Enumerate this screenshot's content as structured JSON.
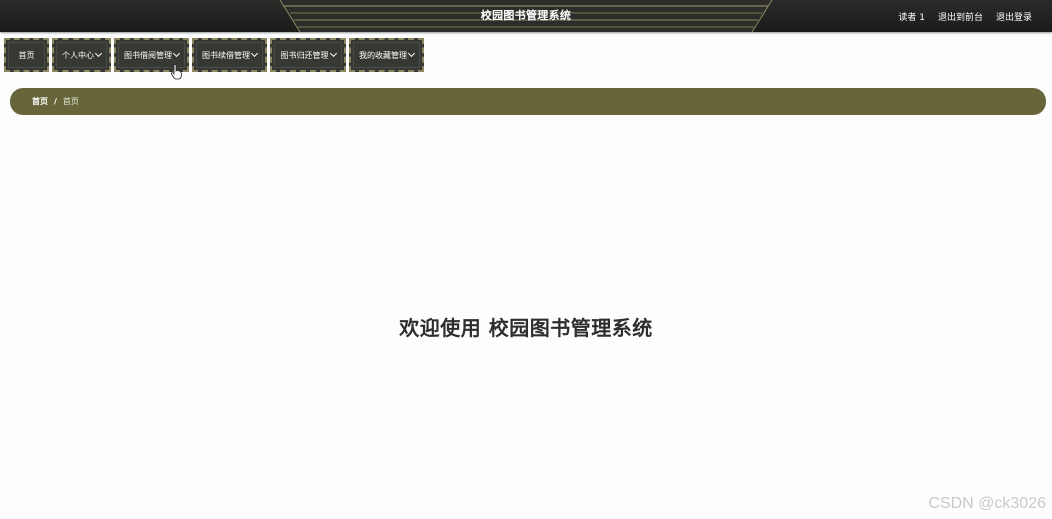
{
  "header": {
    "title": "校园图书管理系统",
    "user_label": "读者 1",
    "links": [
      "退出到前台",
      "退出登录"
    ]
  },
  "nav": {
    "items": [
      {
        "label": "首页",
        "has_dropdown": false
      },
      {
        "label": "个人中心",
        "has_dropdown": true
      },
      {
        "label": "图书借阅管理",
        "has_dropdown": true
      },
      {
        "label": "图书续借管理",
        "has_dropdown": true
      },
      {
        "label": "图书归还管理",
        "has_dropdown": true
      },
      {
        "label": "我的收藏管理",
        "has_dropdown": true
      }
    ]
  },
  "breadcrumb": {
    "home": "首页",
    "separator": "/",
    "current": "首页"
  },
  "main": {
    "welcome": "欢迎使用 校园图书管理系统"
  },
  "watermark": "CSDN @ck3026",
  "colors": {
    "header_bg": "#1f201e",
    "nav_bg": "#363834",
    "nav_border": "#8c8760",
    "breadcrumb_bg": "#66663a"
  }
}
